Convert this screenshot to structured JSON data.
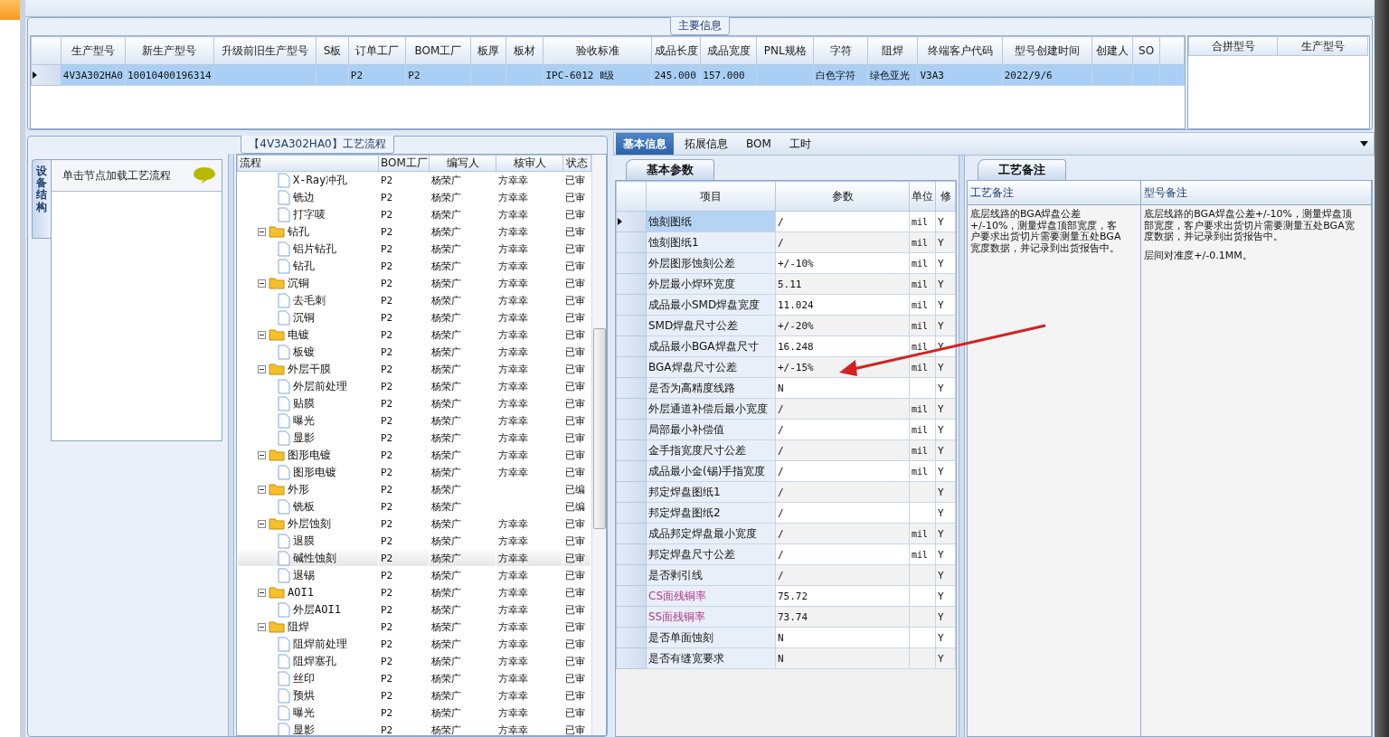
{
  "main_info": {
    "title": "主要信息",
    "columns": [
      "生产型号",
      "新生产型号",
      "升级前旧生产型号",
      "S板",
      "订单工厂",
      "BOM工厂",
      "板厚",
      "板材",
      "验收标准",
      "成品长度",
      "成品宽度",
      "PNL规格",
      "字符",
      "阻焊",
      "终端客户代码",
      "型号创建时间",
      "创建人",
      "SO"
    ],
    "rows": [
      {
        "selected": true,
        "cells": [
          "4V3A302HA0",
          "10010400196314",
          null,
          null,
          "P2",
          "P2",
          null,
          null,
          "IPC-6012 Ⅱ级",
          "245.000",
          "157.000",
          null,
          "白色字符",
          "绿色亚光",
          "V3A3",
          "2022/9/6",
          null,
          null
        ]
      }
    ],
    "merge_columns": [
      "合拼型号",
      "生产型号"
    ]
  },
  "process": {
    "title": "【4V3A302HA0】工艺流程",
    "side_tab": "设备结构",
    "side_hint": "单击节点加载工艺流程",
    "columns": [
      "流程",
      "BOM工厂",
      "编写人",
      "核审人",
      "状态"
    ],
    "partial_children": [
      {
        "name": "X-Ray冲孔",
        "bom": "P2",
        "writer": "杨荣广",
        "reviewer": "方幸幸",
        "status": "已审",
        "selected": false
      },
      {
        "name": "铣边",
        "bom": "P2",
        "writer": "杨荣广",
        "reviewer": "方幸幸",
        "status": "已审",
        "selected": false
      },
      {
        "name": "打字唛",
        "bom": "P2",
        "writer": "杨荣广",
        "reviewer": "方幸幸",
        "status": "已审",
        "selected": false
      }
    ],
    "nodes": [
      {
        "name": "钻孔",
        "bom": "P2",
        "writer": "杨荣广",
        "reviewer": "方幸幸",
        "status": "已审",
        "selected": false,
        "expanded": true,
        "children": [
          {
            "name": "铝片钻孔",
            "bom": "P2",
            "writer": "杨荣广",
            "reviewer": "方幸幸",
            "status": "已审",
            "selected": false
          },
          {
            "name": "钻孔",
            "bom": "P2",
            "writer": "杨荣广",
            "reviewer": "方幸幸",
            "status": "已审",
            "selected": false
          }
        ]
      },
      {
        "name": "沉铜",
        "bom": "P2",
        "writer": "杨荣广",
        "reviewer": "方幸幸",
        "status": "已审",
        "selected": false,
        "expanded": true,
        "children": [
          {
            "name": "去毛刺",
            "bom": "P2",
            "writer": "杨荣广",
            "reviewer": "方幸幸",
            "status": "已审",
            "selected": false
          },
          {
            "name": "沉铜",
            "bom": "P2",
            "writer": "杨荣广",
            "reviewer": "方幸幸",
            "status": "已审",
            "selected": false
          }
        ]
      },
      {
        "name": "电镀",
        "bom": "P2",
        "writer": "杨荣广",
        "reviewer": "方幸幸",
        "status": "已审",
        "selected": false,
        "expanded": true,
        "children": [
          {
            "name": "板镀",
            "bom": "P2",
            "writer": "杨荣广",
            "reviewer": "方幸幸",
            "status": "已审",
            "selected": false
          }
        ]
      },
      {
        "name": "外层干膜",
        "bom": "P2",
        "writer": "杨荣广",
        "reviewer": "方幸幸",
        "status": "已审",
        "selected": false,
        "expanded": true,
        "children": [
          {
            "name": "外层前处理",
            "bom": "P2",
            "writer": "杨荣广",
            "reviewer": "方幸幸",
            "status": "已审",
            "selected": false
          },
          {
            "name": "贴膜",
            "bom": "P2",
            "writer": "杨荣广",
            "reviewer": "方幸幸",
            "status": "已审",
            "selected": false
          },
          {
            "name": "曝光",
            "bom": "P2",
            "writer": "杨荣广",
            "reviewer": "方幸幸",
            "status": "已审",
            "selected": false
          },
          {
            "name": "显影",
            "bom": "P2",
            "writer": "杨荣广",
            "reviewer": "方幸幸",
            "status": "已审",
            "selected": false
          }
        ]
      },
      {
        "name": "图形电镀",
        "bom": "P2",
        "writer": "杨荣广",
        "reviewer": "方幸幸",
        "status": "已审",
        "selected": false,
        "expanded": true,
        "children": [
          {
            "name": "图形电镀",
            "bom": "P2",
            "writer": "杨荣广",
            "reviewer": "方幸幸",
            "status": "已审",
            "selected": false
          }
        ]
      },
      {
        "name": "外形",
        "bom": "P2",
        "writer": "杨荣广",
        "status": "已编",
        "selected": false,
        "expanded": true,
        "children": [
          {
            "name": "铣板",
            "bom": "P2",
            "writer": "杨荣广",
            "status": "已编",
            "selected": false
          }
        ]
      },
      {
        "name": "外层蚀刻",
        "bom": "P2",
        "writer": "杨荣广",
        "reviewer": "方幸幸",
        "status": "已审",
        "selected": false,
        "expanded": true,
        "children": [
          {
            "name": "退膜",
            "bom": "P2",
            "writer": "杨荣广",
            "reviewer": "方幸幸",
            "status": "已审",
            "selected": false
          },
          {
            "name": "碱性蚀刻",
            "bom": "P2",
            "writer": "杨荣广",
            "reviewer": "方幸幸",
            "status": "已审",
            "selected": true
          },
          {
            "name": "退锡",
            "bom": "P2",
            "writer": "杨荣广",
            "reviewer": "方幸幸",
            "status": "已审",
            "selected": false
          }
        ]
      },
      {
        "name": "AOI1",
        "bom": "P2",
        "writer": "杨荣广",
        "reviewer": "方幸幸",
        "status": "已审",
        "selected": false,
        "expanded": true,
        "children": [
          {
            "name": "外层AOI1",
            "bom": "P2",
            "writer": "杨荣广",
            "reviewer": "方幸幸",
            "status": "已审",
            "selected": false
          }
        ]
      },
      {
        "name": "阻焊",
        "bom": "P2",
        "writer": "杨荣广",
        "reviewer": "方幸幸",
        "status": "已审",
        "selected": false,
        "expanded": true,
        "children": [
          {
            "name": "阻焊前处理",
            "bom": "P2",
            "writer": "杨荣广",
            "reviewer": "方幸幸",
            "status": "已审",
            "selected": false
          },
          {
            "name": "阻焊塞孔",
            "bom": "P2",
            "writer": "杨荣广",
            "reviewer": "方幸幸",
            "status": "已审",
            "selected": false
          },
          {
            "name": "丝印",
            "bom": "P2",
            "writer": "杨荣广",
            "reviewer": "方幸幸",
            "status": "已审",
            "selected": false
          },
          {
            "name": "预烘",
            "bom": "P2",
            "writer": "杨荣广",
            "reviewer": "方幸幸",
            "status": "已审",
            "selected": false
          },
          {
            "name": "曝光",
            "bom": "P2",
            "writer": "杨荣广",
            "reviewer": "方幸幸",
            "status": "已审",
            "selected": false
          },
          {
            "name": "显影",
            "bom": "P2",
            "writer": "杨荣广",
            "reviewer": "方幸幸",
            "status": "已审",
            "selected": false
          }
        ]
      }
    ]
  },
  "tabs": [
    {
      "label": "基本信息",
      "selected": true
    },
    {
      "label": "拓展信息",
      "selected": false
    },
    {
      "label": "BOM",
      "selected": false
    },
    {
      "label": "工时",
      "selected": false
    }
  ],
  "params": {
    "tab": "基本参数",
    "columns": [
      "项目",
      "参数",
      "单位",
      "修"
    ],
    "rows": [
      {
        "item": "蚀刻图纸",
        "value": "/",
        "unit": "mil",
        "mod": "Y",
        "selected": true
      },
      {
        "item": "蚀刻图纸1",
        "value": "/",
        "unit": "mil",
        "mod": "Y",
        "selected": false
      },
      {
        "item": "外层图形蚀刻公差",
        "value": "+/-10%",
        "unit": "mil",
        "mod": "Y",
        "selected": false
      },
      {
        "item": "外层最小焊环宽度",
        "value": "5.11",
        "unit": "mil",
        "mod": "Y",
        "selected": false
      },
      {
        "item": "成品最小SMD焊盘宽度",
        "value": "11.024",
        "unit": "mil",
        "mod": "Y",
        "selected": false
      },
      {
        "item": "SMD焊盘尺寸公差",
        "value": "+/-20%",
        "unit": "mil",
        "mod": "Y",
        "selected": false
      },
      {
        "item": "成品最小BGA焊盘尺寸",
        "value": "16.248",
        "unit": "mil",
        "mod": "Y",
        "selected": false
      },
      {
        "item": "BGA焊盘尺寸公差",
        "value": "+/-15%",
        "unit": "mil",
        "mod": "Y",
        "selected": false
      },
      {
        "item": "是否为高精度线路",
        "value": "N",
        "mod": "Y",
        "selected": false
      },
      {
        "item": "外层通道补偿后最小宽度",
        "value": "/",
        "unit": "mil",
        "mod": "Y",
        "selected": false
      },
      {
        "item": "局部最小补偿值",
        "value": "/",
        "unit": "mil",
        "mod": "Y",
        "selected": false
      },
      {
        "item": "金手指宽度尺寸公差",
        "value": "/",
        "unit": "mil",
        "mod": "Y",
        "selected": false
      },
      {
        "item": "成品最小金(锡)手指宽度",
        "value": "/",
        "unit": "mil",
        "mod": "Y",
        "selected": false
      },
      {
        "item": "邦定焊盘图纸1",
        "value": "/",
        "mod": "Y",
        "selected": false
      },
      {
        "item": "邦定焊盘图纸2",
        "value": "/",
        "mod": "Y",
        "selected": false
      },
      {
        "item": "成品邦定焊盘最小宽度",
        "value": "/",
        "unit": "mil",
        "mod": "Y",
        "selected": false
      },
      {
        "item": "邦定焊盘尺寸公差",
        "value": "/",
        "unit": "mil",
        "mod": "Y",
        "selected": false
      },
      {
        "item": "是否剥引线",
        "value": "/",
        "mod": "Y",
        "selected": false
      },
      {
        "item": "CS面残铜率",
        "value": "75.72",
        "mod": "Y",
        "selected": false,
        "color": "#b03a8a"
      },
      {
        "item": "SS面残铜率",
        "value": "73.74",
        "mod": "Y",
        "selected": false,
        "color": "#b03a8a"
      },
      {
        "item": "是否单面蚀刻",
        "value": "N",
        "mod": "Y",
        "selected": false
      },
      {
        "item": "是否有缝宽要求",
        "value": "N",
        "mod": "Y",
        "selected": false
      }
    ]
  },
  "notes": {
    "tab": "工艺备注",
    "columns": [
      "工艺备注",
      "型号备注"
    ],
    "process_note": [
      "底层线路的BGA焊盘公差+/-10%，测量焊盘顶部宽度，客户要求出货切片需要测量五处BGA宽度数据，并记录到出货报告中。"
    ],
    "model_note": [
      "底层线路的BGA焊盘公差+/-10%，测量焊盘顶部宽度，客户要求出货切片需要测量五处BGA宽度数据，并记录到出货报告中。",
      "层间对准度+/-0.1MM。"
    ]
  }
}
